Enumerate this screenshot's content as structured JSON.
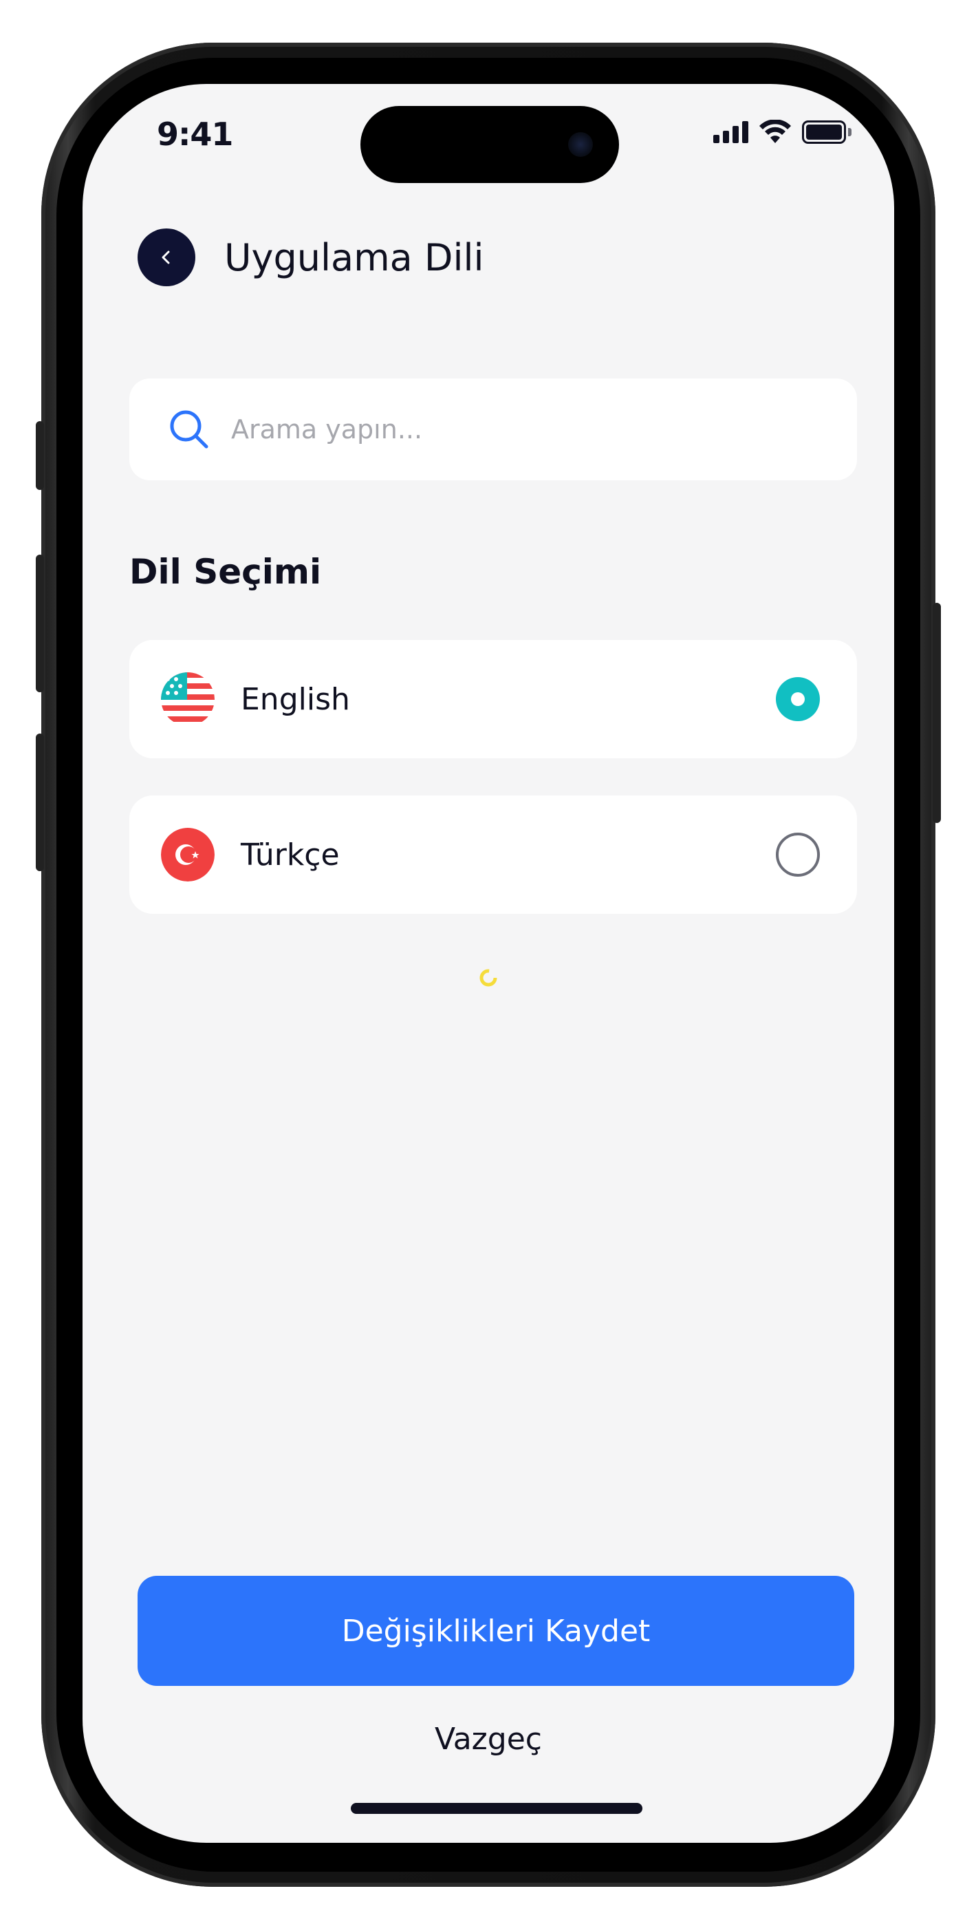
{
  "status_bar": {
    "time": "9:41"
  },
  "header": {
    "title": "Uygulama Dili"
  },
  "search": {
    "placeholder": "Arama yapın..."
  },
  "section": {
    "title": "Dil Seçimi"
  },
  "languages": [
    {
      "label": "English",
      "flag": "us-flag-icon",
      "selected": true
    },
    {
      "label": "Türkçe",
      "flag": "tr-flag-icon",
      "selected": false
    }
  ],
  "actions": {
    "save_label": "Değişiklikleri Kaydet",
    "cancel_label": "Vazgeç"
  },
  "colors": {
    "accent": "#2c74fb",
    "radio_selected": "#11bfc2",
    "dark": "#0f1233"
  }
}
